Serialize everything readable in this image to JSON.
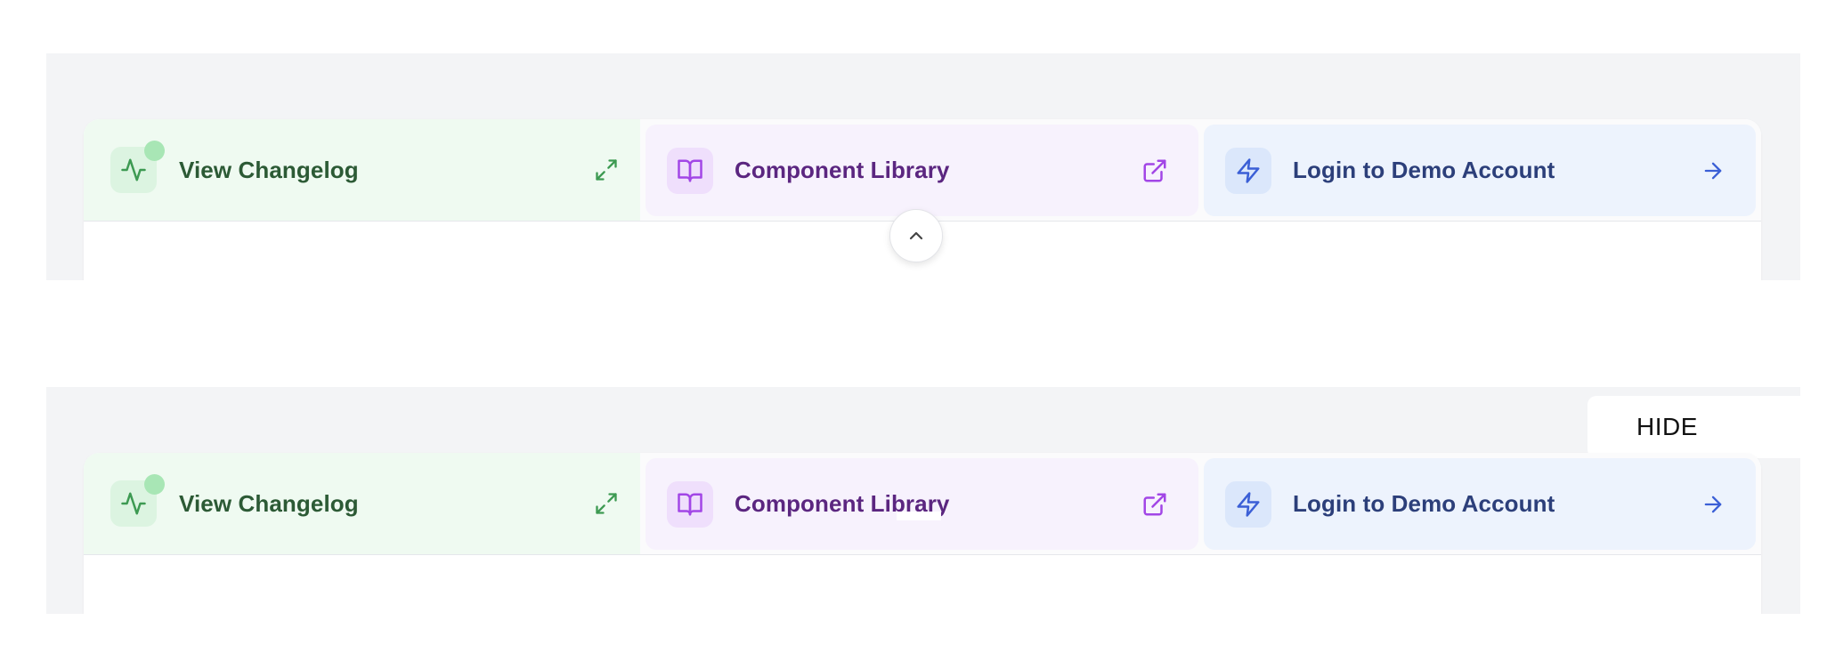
{
  "states": [
    {
      "quick_links": {
        "changelog": {
          "label": "View Changelog",
          "icon": "activity-icon",
          "action_icon": "expand-icon"
        },
        "components": {
          "label": "Component Library",
          "icon": "book-open-icon",
          "action_icon": "external-link-icon"
        },
        "demo": {
          "label": "Login to Demo Account",
          "icon": "zap-icon",
          "action_icon": "arrow-right-icon"
        }
      },
      "collapse_button_icon": "chevron-up-icon"
    },
    {
      "hide_button": {
        "label": "HIDE"
      },
      "quick_links": {
        "changelog": {
          "label": "View Changelog",
          "icon": "activity-icon",
          "action_icon": "expand-icon"
        },
        "components": {
          "label": "Component Library",
          "icon": "book-open-icon",
          "action_icon": "external-link-icon"
        },
        "demo": {
          "label": "Login to Demo Account",
          "icon": "zap-icon",
          "action_icon": "arrow-right-icon"
        }
      }
    }
  ],
  "colors": {
    "green_bg": "#effaf1",
    "green_text": "#2c5a35",
    "green_icon": "#3d9a52",
    "purple_bg": "#f7f2fd",
    "purple_text": "#5b2680",
    "purple_icon": "#a246e6",
    "blue_bg": "#edf3fd",
    "blue_text": "#2c3f7a",
    "blue_icon": "#3b5fd6"
  }
}
